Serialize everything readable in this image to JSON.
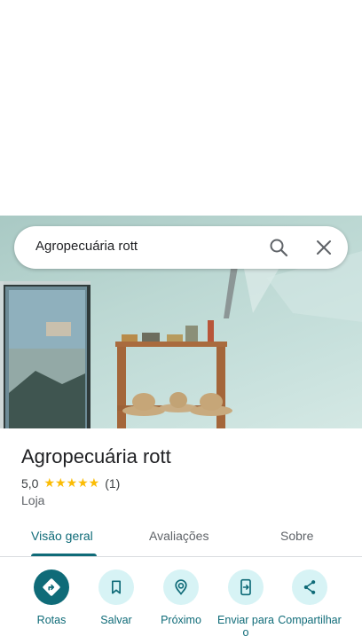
{
  "search": {
    "query": "Agropecuária rott"
  },
  "place": {
    "title": "Agropecuária rott",
    "rating": "5,0",
    "stars": "★★★★★",
    "review_count": "(1)",
    "category": "Loja"
  },
  "tabs": [
    {
      "label": "Visão geral",
      "active": true
    },
    {
      "label": "Avaliações",
      "active": false
    },
    {
      "label": "Sobre",
      "active": false
    }
  ],
  "actions": [
    {
      "label": "Rotas",
      "icon": "directions-icon"
    },
    {
      "label": "Salvar",
      "icon": "bookmark-icon"
    },
    {
      "label": "Próximo",
      "icon": "nearby-icon"
    },
    {
      "label": "Enviar para o",
      "icon": "send-to-phone-icon"
    },
    {
      "label": "Compartilhar",
      "icon": "share-icon"
    }
  ],
  "colors": {
    "accent": "#0f6b78",
    "action_bg": "#d7f3f5",
    "star": "#fbbc04"
  }
}
